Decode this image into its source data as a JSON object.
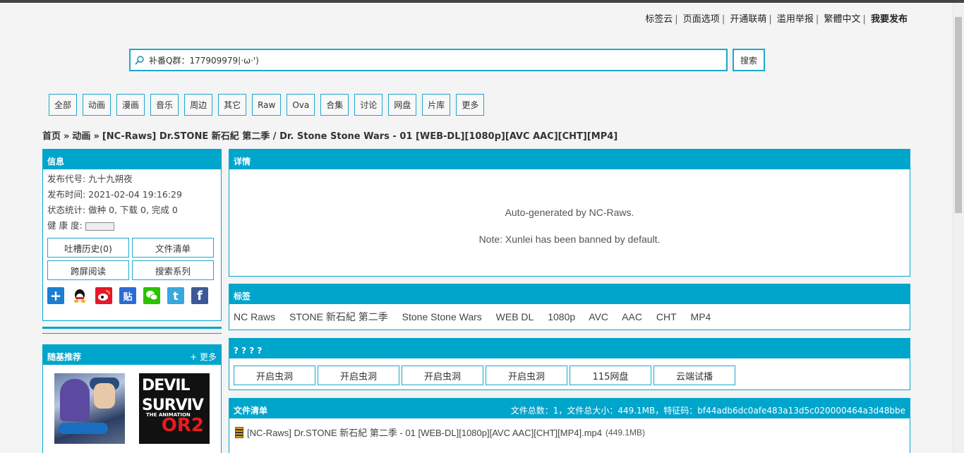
{
  "toplinks": [
    "标签云",
    "页面选项",
    "开通联萌",
    "滥用举报",
    "繁體中文",
    "我要发布"
  ],
  "search": {
    "value": "补番Q群：177909979|·ω·')",
    "button": "搜索"
  },
  "categories": [
    "全部",
    "动画",
    "漫画",
    "音乐",
    "周边",
    "其它",
    "Raw",
    "Ova",
    "合集",
    "讨论",
    "网盘",
    "片库",
    "更多"
  ],
  "breadcrumb": {
    "home": "首页",
    "section": "动画",
    "title": "[NC-Raws] Dr.STONE 新石紀 第二季 / Dr. Stone Stone Wars - 01 [WEB-DL][1080p][AVC AAC][CHT][MP4]"
  },
  "info": {
    "title": "信息",
    "publisher": "发布代号: 九十九朔夜",
    "time": "发布时间: 2021-02-04 19:16:29",
    "stats": "状态统计: 做种 0, 下载 0, 完成 0",
    "health_label": "健 康 度:",
    "buttons": [
      "吐槽历史(0)",
      "文件清单",
      "跨屏阅读",
      "搜索系列"
    ]
  },
  "random": {
    "title": "随基推荐",
    "more": "+ 更多",
    "thumb2_lines": [
      "DEVIL",
      "SURVIV",
      "THE ANIMATION",
      "OR2"
    ]
  },
  "detail": {
    "title": "详情",
    "line1": "Auto-generated by NC-Raws.",
    "line2": "Note: Xunlei has been banned by default."
  },
  "tags": {
    "title": "标签",
    "items": [
      "NC Raws",
      "STONE 新石紀 第二季",
      "Stone Stone Wars",
      "WEB DL",
      "1080p",
      "AVC",
      "AAC",
      "CHT",
      "MP4"
    ]
  },
  "download": {
    "title": "? ? ? ?",
    "buttons": [
      "开启虫洞",
      "开启虫洞",
      "开启虫洞",
      "开启虫洞",
      "115网盘",
      "云端试播"
    ]
  },
  "files": {
    "title": "文件清单",
    "summary": "文件总数：1，文件总大小：449.1MB，特征码：bf44adb6dc0afe483a13d5c020000464a3d48bbe",
    "name": "[NC-Raws] Dr.STONE 新石紀 第二季 - 01 [WEB-DL][1080p][AVC AAC][CHT][MP4].mp4",
    "size": "(449.1MB)"
  },
  "colors": {
    "accent": "#00a5cc"
  }
}
